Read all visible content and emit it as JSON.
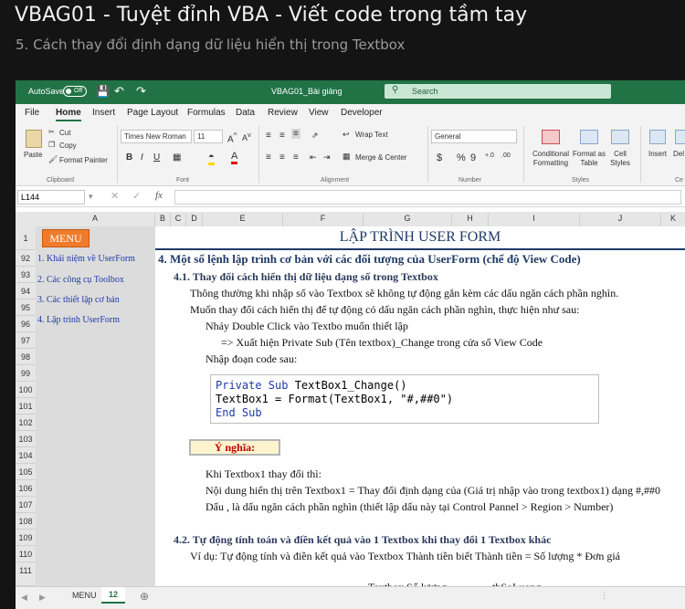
{
  "video": {
    "title": "VBAG01 - Tuyệt đỉnh VBA - Viết code trong tầm tay",
    "subtitle": "5. Cách thay đổi định dạng dữ liệu hiển thị trong Textbox"
  },
  "titlebar": {
    "autosave": "AutoSave",
    "toggle": "Off",
    "filename": "VBAG01_Bài giảng",
    "search": "Search"
  },
  "menu": [
    "File",
    "Home",
    "Insert",
    "Page Layout",
    "Formulas",
    "Data",
    "Review",
    "View",
    "Developer"
  ],
  "ribbon": {
    "paste": "Paste",
    "cut": "Cut",
    "copy": "Copy",
    "format_painter": "Format Painter",
    "clipboard": "Clipboard",
    "font_name": "Times New Roman",
    "font_size": "11",
    "bold": "B",
    "italic": "I",
    "underline": "U",
    "font_group": "Font",
    "wrap_text": "Wrap Text",
    "merge_center": "Merge & Center",
    "alignment": "Alignment",
    "number_format": "General",
    "currency": "$",
    "percent": "%",
    "comma": "9",
    "number": "Number",
    "cond_format": "Conditional Formatting",
    "format_table": "Format as Table",
    "cell_styles": "Cell Styles",
    "styles": "Styles",
    "insert": "Insert",
    "delete": "Del",
    "cells": "Ce"
  },
  "formula_bar": {
    "name_box": "L144",
    "fx": "fx"
  },
  "columns": [
    "A",
    "B",
    "C",
    "D",
    "E",
    "F",
    "G",
    "H",
    "I",
    "J",
    "K"
  ],
  "rows": [
    "1",
    "92",
    "93",
    "94",
    "95",
    "96",
    "97",
    "98",
    "99",
    "100",
    "101",
    "102",
    "103",
    "104",
    "105",
    "106",
    "107",
    "108",
    "109",
    "110",
    "111"
  ],
  "sidebar": {
    "menu_btn": "MENU",
    "items": [
      "1. Khái niệm về UserForm",
      "2. Các công cụ Toolbox",
      "3. Các thiết lập cơ bản",
      "4. Lập trình UserForm"
    ]
  },
  "content": {
    "header": "LẬP TRÌNH USER FORM",
    "section": "4. Một số lệnh lập trình cơ bản với các đối tượng của UserForm (chế độ View Code)",
    "sub1": "4.1. Thay đổi cách hiển thị dữ liệu dạng số trong Textbox",
    "l94": "Thông thường khi nhập số vào Textbox sẽ không tự động gắn kèm các dấu ngăn cách phần nghìn.",
    "l95": "Muốn thay đổi cách hiển thị để tự động có dấu ngăn cách phần nghìn, thực hiện như sau:",
    "l96": "Nháy Double Click vào Textbo muốn thiết lập",
    "l97": "=> Xuất hiện Private Sub (Tên textbox)_Change trong cửa sổ View Code",
    "l98": "Nhập đoạn code sau:",
    "code1a": "Private Sub",
    "code1b": " TextBox1_Change()",
    "code2": "TextBox1 = Format(TextBox1, \"#,##0\")",
    "code3": "End Sub",
    "note": "Ý nghĩa:",
    "l104": "Khi Textbox1 thay đổi thì:",
    "l105": "Nội dung hiển thị trên Textbox1 = Thay đổi định dạng của (Giá trị nhập vào trong textbox1) dạng #,##0",
    "l106": "Dấu , là dấu ngăn cách phần nghìn (thiết lập dấu này tại Control Pannel > Region > Number)",
    "sub2": "4.2. Tự động tính toán và điền kết quả vào 1 Textbox khi thay đổi 1 Textbox khác",
    "l109": "Ví dụ: Tự động tính và điền kết quả vào Textbox Thành tiền biết Thành tiền = Số lượng * Đơn giá",
    "l111a": "Textbox Số lượng",
    "l111b": "tbSoLuong"
  },
  "sheets": [
    "MENU",
    "12"
  ],
  "colors": {
    "excel_green": "#217346",
    "menu_orange": "#f07b2c",
    "link_blue": "#1f3aa8"
  }
}
